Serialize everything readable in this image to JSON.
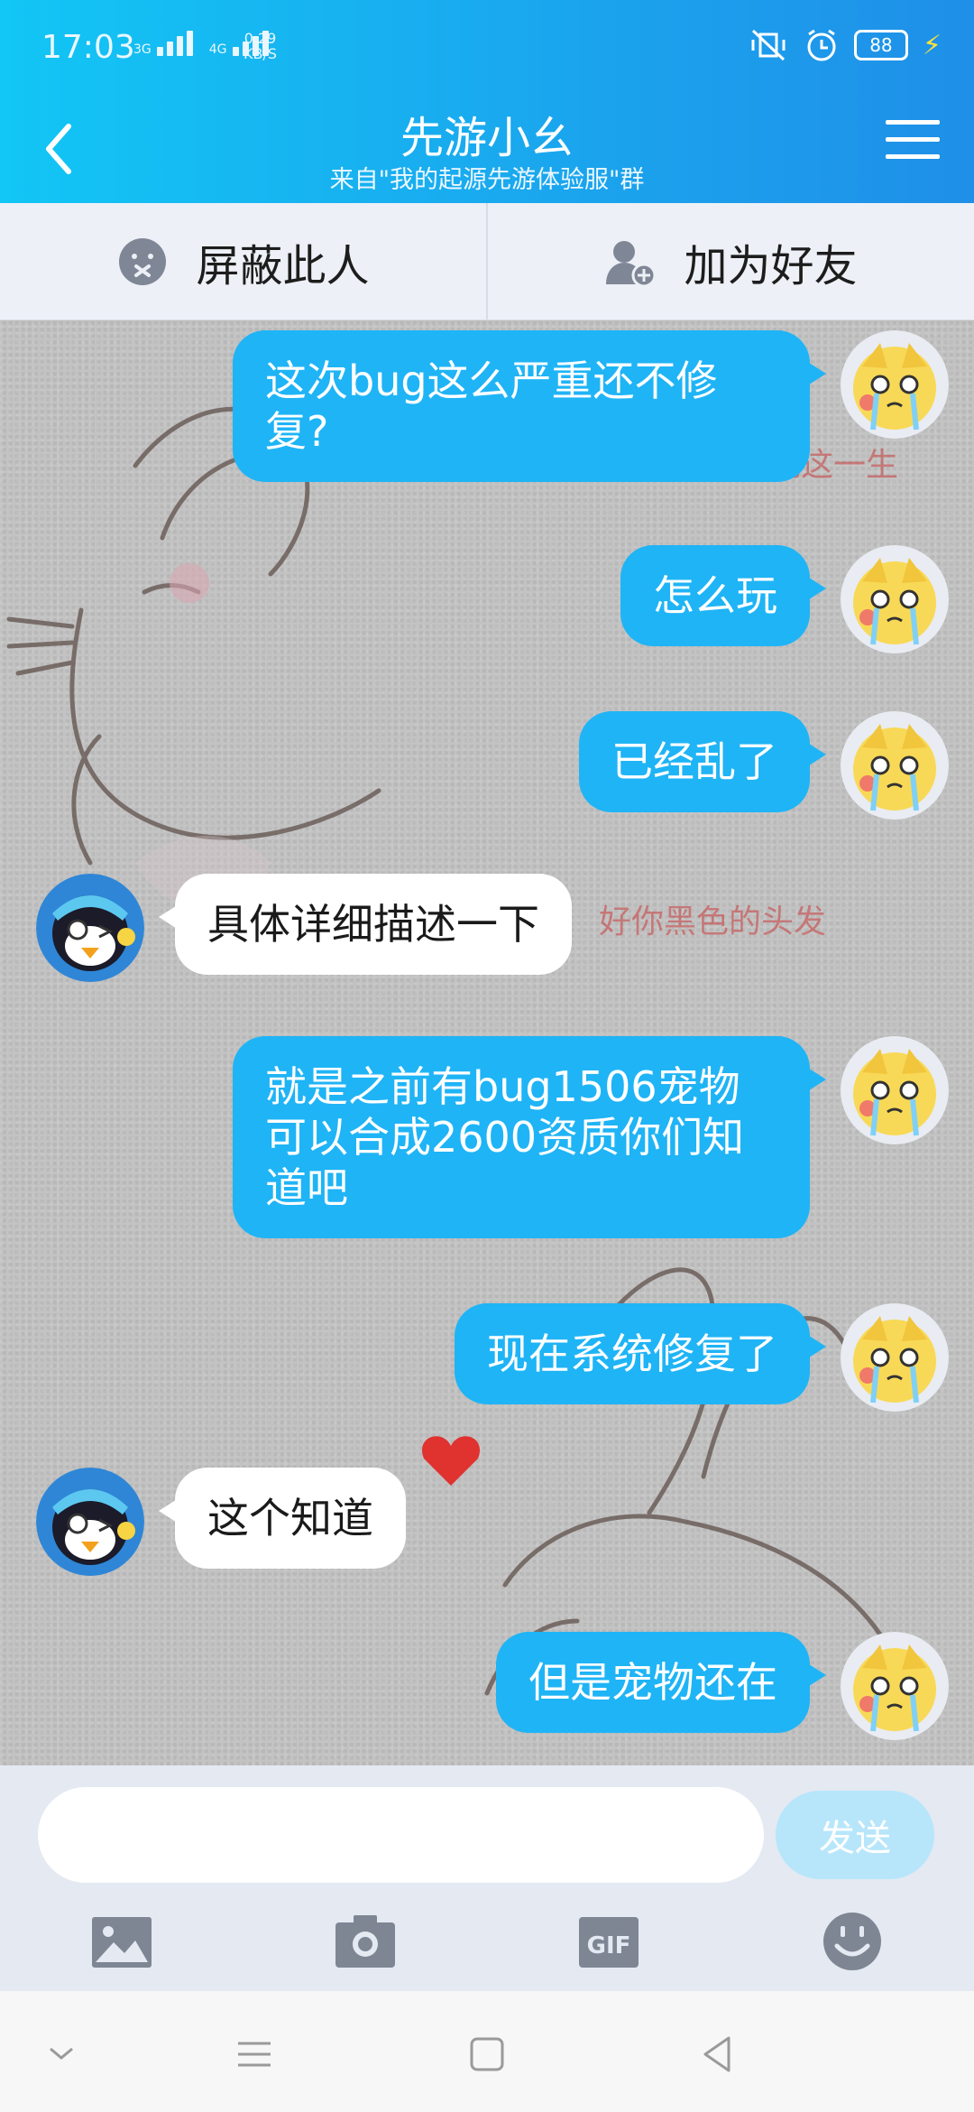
{
  "status_bar": {
    "time": "17:03",
    "sim1_tag": "3G",
    "sim2_tag": "4G",
    "speed_value": "0.29",
    "speed_unit": "KB/S",
    "battery": "88"
  },
  "header": {
    "title": "先游小幺",
    "subtitle": "来自\"我的起源先游体验服\"群"
  },
  "actions": {
    "block_label": "屏蔽此人",
    "add_friend_label": "加为好友"
  },
  "background_text": {
    "line1": "醉来后能配的天醉过完这一生",
    "line2": "好你黑色的头发"
  },
  "messages": [
    {
      "side": "right",
      "text": "这次bug这么严重还不修复?"
    },
    {
      "side": "right",
      "text": "怎么玩"
    },
    {
      "side": "right",
      "text": "已经乱了"
    },
    {
      "side": "left",
      "text": "具体详细描述一下"
    },
    {
      "side": "right",
      "text": "就是之前有bug1506宠物可以合成2600资质你们知道吧"
    },
    {
      "side": "right",
      "text": "现在系统修复了"
    },
    {
      "side": "left",
      "text": "这个知道"
    },
    {
      "side": "right",
      "text": "但是宠物还在"
    }
  ],
  "input": {
    "placeholder": "",
    "send_label": "发送"
  },
  "toolbar": {
    "icons": [
      "image-icon",
      "camera-icon",
      "gif-icon",
      "emoji-icon"
    ],
    "gif_label": "GIF"
  },
  "colors": {
    "header_start": "#12c6f5",
    "header_end": "#1f8fe8",
    "bubble_self": "#1fb4f6",
    "bubble_other": "#ffffff",
    "send_disabled": "#b7e6fb"
  }
}
